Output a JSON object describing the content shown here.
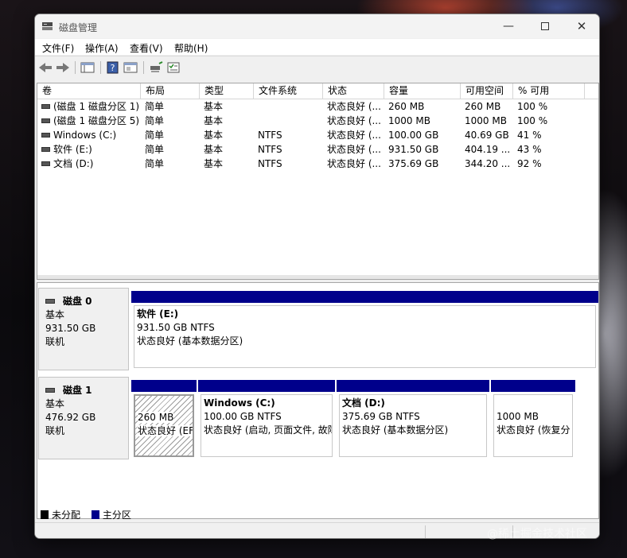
{
  "window": {
    "title": "磁盘管理"
  },
  "menu": [
    "文件(F)",
    "操作(A)",
    "查看(V)",
    "帮助(H)"
  ],
  "columns": [
    "卷",
    "布局",
    "类型",
    "文件系统",
    "状态",
    "容量",
    "可用空间",
    "% 可用"
  ],
  "volumes": [
    {
      "name": "(磁盘 1 磁盘分区 1)",
      "layout": "简单",
      "type": "基本",
      "fs": "",
      "status": "状态良好 (...",
      "capacity": "260 MB",
      "free": "260 MB",
      "pct": "100 %"
    },
    {
      "name": "(磁盘 1 磁盘分区 5)",
      "layout": "简单",
      "type": "基本",
      "fs": "",
      "status": "状态良好 (...",
      "capacity": "1000 MB",
      "free": "1000 MB",
      "pct": "100 %"
    },
    {
      "name": "Windows (C:)",
      "layout": "简单",
      "type": "基本",
      "fs": "NTFS",
      "status": "状态良好 (...",
      "capacity": "100.00 GB",
      "free": "40.69 GB",
      "pct": "41 %"
    },
    {
      "name": "软件 (E:)",
      "layout": "简单",
      "type": "基本",
      "fs": "NTFS",
      "status": "状态良好 (...",
      "capacity": "931.50 GB",
      "free": "404.19 ...",
      "pct": "43 %"
    },
    {
      "name": "文档 (D:)",
      "layout": "简单",
      "type": "基本",
      "fs": "NTFS",
      "status": "状态良好 (...",
      "capacity": "375.69 GB",
      "free": "344.20 ...",
      "pct": "92 %"
    }
  ],
  "disks": [
    {
      "name": "磁盘 0",
      "type": "基本",
      "size": "931.50 GB",
      "state": "联机",
      "partitions": [
        {
          "title": "软件  (E:)",
          "size": "931.50 GB NTFS",
          "status": "状态良好 (基本数据分区)"
        }
      ]
    },
    {
      "name": "磁盘 1",
      "type": "基本",
      "size": "476.92 GB",
      "state": "联机",
      "partitions": [
        {
          "title": "",
          "size": "260 MB",
          "status": "状态良好 (EF"
        },
        {
          "title": "Windows  (C:)",
          "size": "100.00 GB NTFS",
          "status": "状态良好 (启动, 页面文件, 故障"
        },
        {
          "title": "文档  (D:)",
          "size": "375.69 GB NTFS",
          "status": "状态良好 (基本数据分区)"
        },
        {
          "title": "",
          "size": "1000 MB",
          "status": "状态良好 (恢复分"
        }
      ]
    }
  ],
  "legend": {
    "unallocated": "未分配",
    "primary": "主分区"
  },
  "colors": {
    "primary": "#00008b",
    "unallocated": "#000000"
  },
  "watermark": "@稀土掘金技术社区"
}
